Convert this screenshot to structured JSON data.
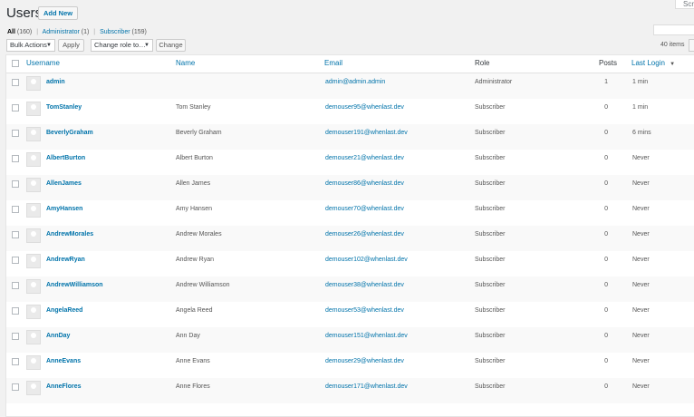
{
  "screen_options": "Scre",
  "title": "Users",
  "add_new": "Add New",
  "filters": {
    "all": "All",
    "all_count": "(160)",
    "administrator": "Administrator",
    "administrator_count": "(1)",
    "subscriber": "Subscriber",
    "subscriber_count": "(159)",
    "separator": "|"
  },
  "bulk_actions": "Bulk Actions",
  "apply": "Apply",
  "change_role": "Change role to…",
  "change": "Change",
  "items_count": "40 items",
  "columns": {
    "username": "Username",
    "name": "Name",
    "email": "Email",
    "role": "Role",
    "posts": "Posts",
    "last_login": "Last Login",
    "sort_indicator": "▼"
  },
  "rows": [
    {
      "username": "admin",
      "name": "",
      "email": "admin@admin.admin",
      "role": "Administrator",
      "posts": "1",
      "login": "1 min"
    },
    {
      "username": "TomStanley",
      "name": "Tom Stanley",
      "email": "demouser95@whenlast.dev",
      "role": "Subscriber",
      "posts": "0",
      "login": "1 min"
    },
    {
      "username": "BeverlyGraham",
      "name": "Beverly Graham",
      "email": "demouser191@whenlast.dev",
      "role": "Subscriber",
      "posts": "0",
      "login": "6 mins"
    },
    {
      "username": "AlbertBurton",
      "name": "Albert Burton",
      "email": "demouser21@whenlast.dev",
      "role": "Subscriber",
      "posts": "0",
      "login": "Never"
    },
    {
      "username": "AllenJames",
      "name": "Allen James",
      "email": "demouser86@whenlast.dev",
      "role": "Subscriber",
      "posts": "0",
      "login": "Never"
    },
    {
      "username": "AmyHansen",
      "name": "Amy Hansen",
      "email": "demouser70@whenlast.dev",
      "role": "Subscriber",
      "posts": "0",
      "login": "Never"
    },
    {
      "username": "AndrewMorales",
      "name": "Andrew Morales",
      "email": "demouser26@whenlast.dev",
      "role": "Subscriber",
      "posts": "0",
      "login": "Never"
    },
    {
      "username": "AndrewRyan",
      "name": "Andrew Ryan",
      "email": "demouser102@whenlast.dev",
      "role": "Subscriber",
      "posts": "0",
      "login": "Never"
    },
    {
      "username": "AndrewWilliamson",
      "name": "Andrew Williamson",
      "email": "demouser38@whenlast.dev",
      "role": "Subscriber",
      "posts": "0",
      "login": "Never"
    },
    {
      "username": "AngelaReed",
      "name": "Angela Reed",
      "email": "demouser53@whenlast.dev",
      "role": "Subscriber",
      "posts": "0",
      "login": "Never"
    },
    {
      "username": "AnnDay",
      "name": "Ann Day",
      "email": "demouser151@whenlast.dev",
      "role": "Subscriber",
      "posts": "0",
      "login": "Never"
    },
    {
      "username": "AnneEvans",
      "name": "Anne Evans",
      "email": "demouser29@whenlast.dev",
      "role": "Subscriber",
      "posts": "0",
      "login": "Never"
    },
    {
      "username": "AnneFlores",
      "name": "Anne Flores",
      "email": "demouser171@whenlast.dev",
      "role": "Subscriber",
      "posts": "0",
      "login": "Never"
    }
  ],
  "colors": {
    "link": "#0073aa",
    "background": "#f1f1f1",
    "row_alt": "#f9f9f9"
  }
}
